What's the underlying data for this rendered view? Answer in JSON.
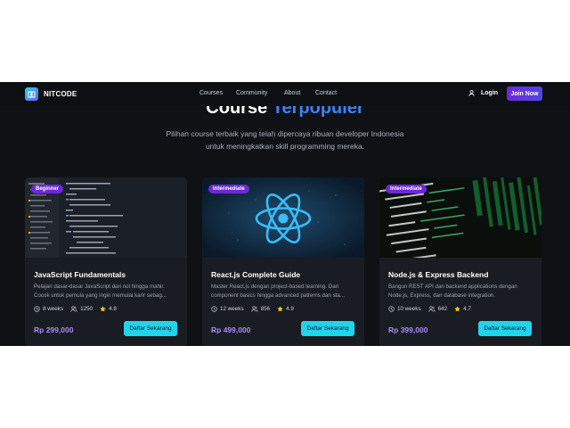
{
  "nav": {
    "brand": "NITCODE",
    "logo_icon": "book-icon",
    "links": [
      "Courses",
      "Community",
      "About",
      "Contact"
    ],
    "login": "Login",
    "join": "Join Now"
  },
  "hero": {
    "title_part1": "Course",
    "title_part2": "Terpopuler",
    "subtitle_line1": "Pilihan course terbaik yang telah dipercaya ribuan developer Indonesia",
    "subtitle_line2": "untuk meningkatkan skill programming mereka."
  },
  "courses": [
    {
      "level": "Beginner",
      "title": "JavaScript Fundamentals",
      "desc": "Pelajari dasar-dasar JavaScript dari nol hingga mahir. Cocok untuk pemula yang ingin memulai karir sebag...",
      "duration": "8 weeks",
      "students": "1250",
      "rating": "4.8",
      "price": "Rp 299,000",
      "cta": "Daftar Sekarang"
    },
    {
      "level": "Intermediate",
      "title": "React.js Complete Guide",
      "desc": "Master React.js dengan project-based learning. Dari component basics hingga advanced patterns dan sta...",
      "duration": "12 weeks",
      "students": "856",
      "rating": "4.9",
      "price": "Rp 499,000",
      "cta": "Daftar Sekarang"
    },
    {
      "level": "Intermediate",
      "title": "Node.js & Express Backend",
      "desc": "Bangun REST API dan backend applications dengan Node.js, Express, dan database integration.",
      "duration": "10 weeks",
      "students": "642",
      "rating": "4.7",
      "price": "Rp 399,000",
      "cta": "Daftar Sekarang"
    }
  ],
  "colors": {
    "background": "#0f1115",
    "card": "#191c22",
    "accent_cyan": "#22d3ee",
    "accent_purple": "#6d28d9",
    "price": "#a78bfa"
  },
  "icons": {
    "duration": "clock-icon",
    "students": "users-icon",
    "rating": "star-icon",
    "user": "user-icon"
  }
}
